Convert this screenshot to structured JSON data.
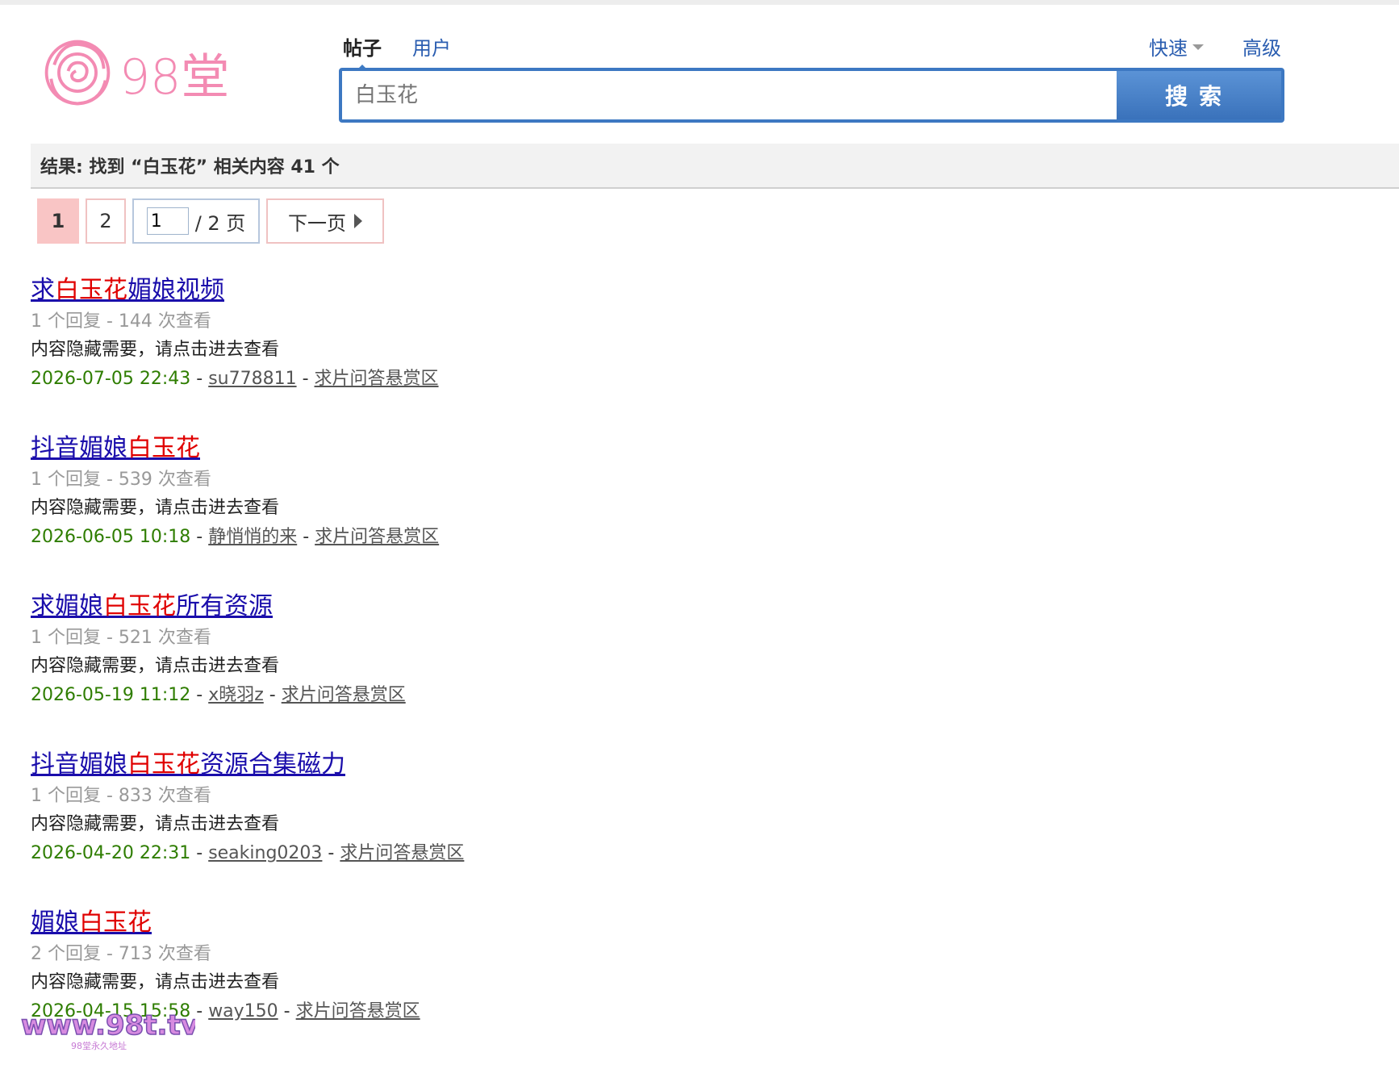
{
  "logo": {
    "text": "98堂"
  },
  "search": {
    "tabs": [
      {
        "label": "帖子"
      },
      {
        "label": "用户"
      }
    ],
    "quick_label": "快速",
    "advanced_label": "高级",
    "placeholder": "白玉花",
    "button_label": "搜索"
  },
  "result_summary": "结果: 找到 “白玉花” 相关内容 41 个",
  "pager": {
    "current": "1",
    "page2": "2",
    "jump_value": "1",
    "total_label": "/ 2 页",
    "next_label": "下一页"
  },
  "results": [
    {
      "title_parts": [
        {
          "text": "求",
          "hl": false
        },
        {
          "text": "白玉花",
          "hl": true
        },
        {
          "text": "媚娘视频",
          "hl": false
        }
      ],
      "meta": "1 个回复 - 144 次查看",
      "desc": "内容隐藏需要，请点击进去查看",
      "date": "2026-07-05 22:43",
      "author": "su778811",
      "forum": "求片问答悬赏区"
    },
    {
      "title_parts": [
        {
          "text": "抖音媚娘",
          "hl": false
        },
        {
          "text": "白玉花",
          "hl": true
        }
      ],
      "meta": "1 个回复 - 539 次查看",
      "desc": "内容隐藏需要，请点击进去查看",
      "date": "2026-06-05 10:18",
      "author": "静悄悄的来",
      "forum": "求片问答悬赏区"
    },
    {
      "title_parts": [
        {
          "text": "求媚娘",
          "hl": false
        },
        {
          "text": "白玉花",
          "hl": true
        },
        {
          "text": "所有资源",
          "hl": false
        }
      ],
      "meta": "1 个回复 - 521 次查看",
      "desc": "内容隐藏需要，请点击进去查看",
      "date": "2026-05-19 11:12",
      "author": "x晓羽z",
      "forum": "求片问答悬赏区"
    },
    {
      "title_parts": [
        {
          "text": "抖音媚娘",
          "hl": false
        },
        {
          "text": "白玉花",
          "hl": true
        },
        {
          "text": "资源合集磁力",
          "hl": false
        }
      ],
      "meta": "1 个回复 - 833 次查看",
      "desc": "内容隐藏需要，请点击进去查看",
      "date": "2026-04-20 22:31",
      "author": "seaking0203",
      "forum": "求片问答悬赏区"
    },
    {
      "title_parts": [
        {
          "text": "媚娘",
          "hl": false
        },
        {
          "text": "白玉花",
          "hl": true
        }
      ],
      "meta": "2 个回复 - 713 次查看",
      "desc": "内容隐藏需要，请点击进去查看",
      "date": "2026-04-15 15:58",
      "author": "way150",
      "forum": "求片问答悬赏区"
    }
  ],
  "watermark": {
    "text": "www.98t.tv",
    "subtext": "98堂永久地址"
  },
  "colors": {
    "accent": "#3d78c2",
    "link": "#1a0dab",
    "highlight": "#e00000",
    "date": "#2e7d00",
    "logo": "#f38bb3",
    "pager_current": "#f9c5c5"
  }
}
